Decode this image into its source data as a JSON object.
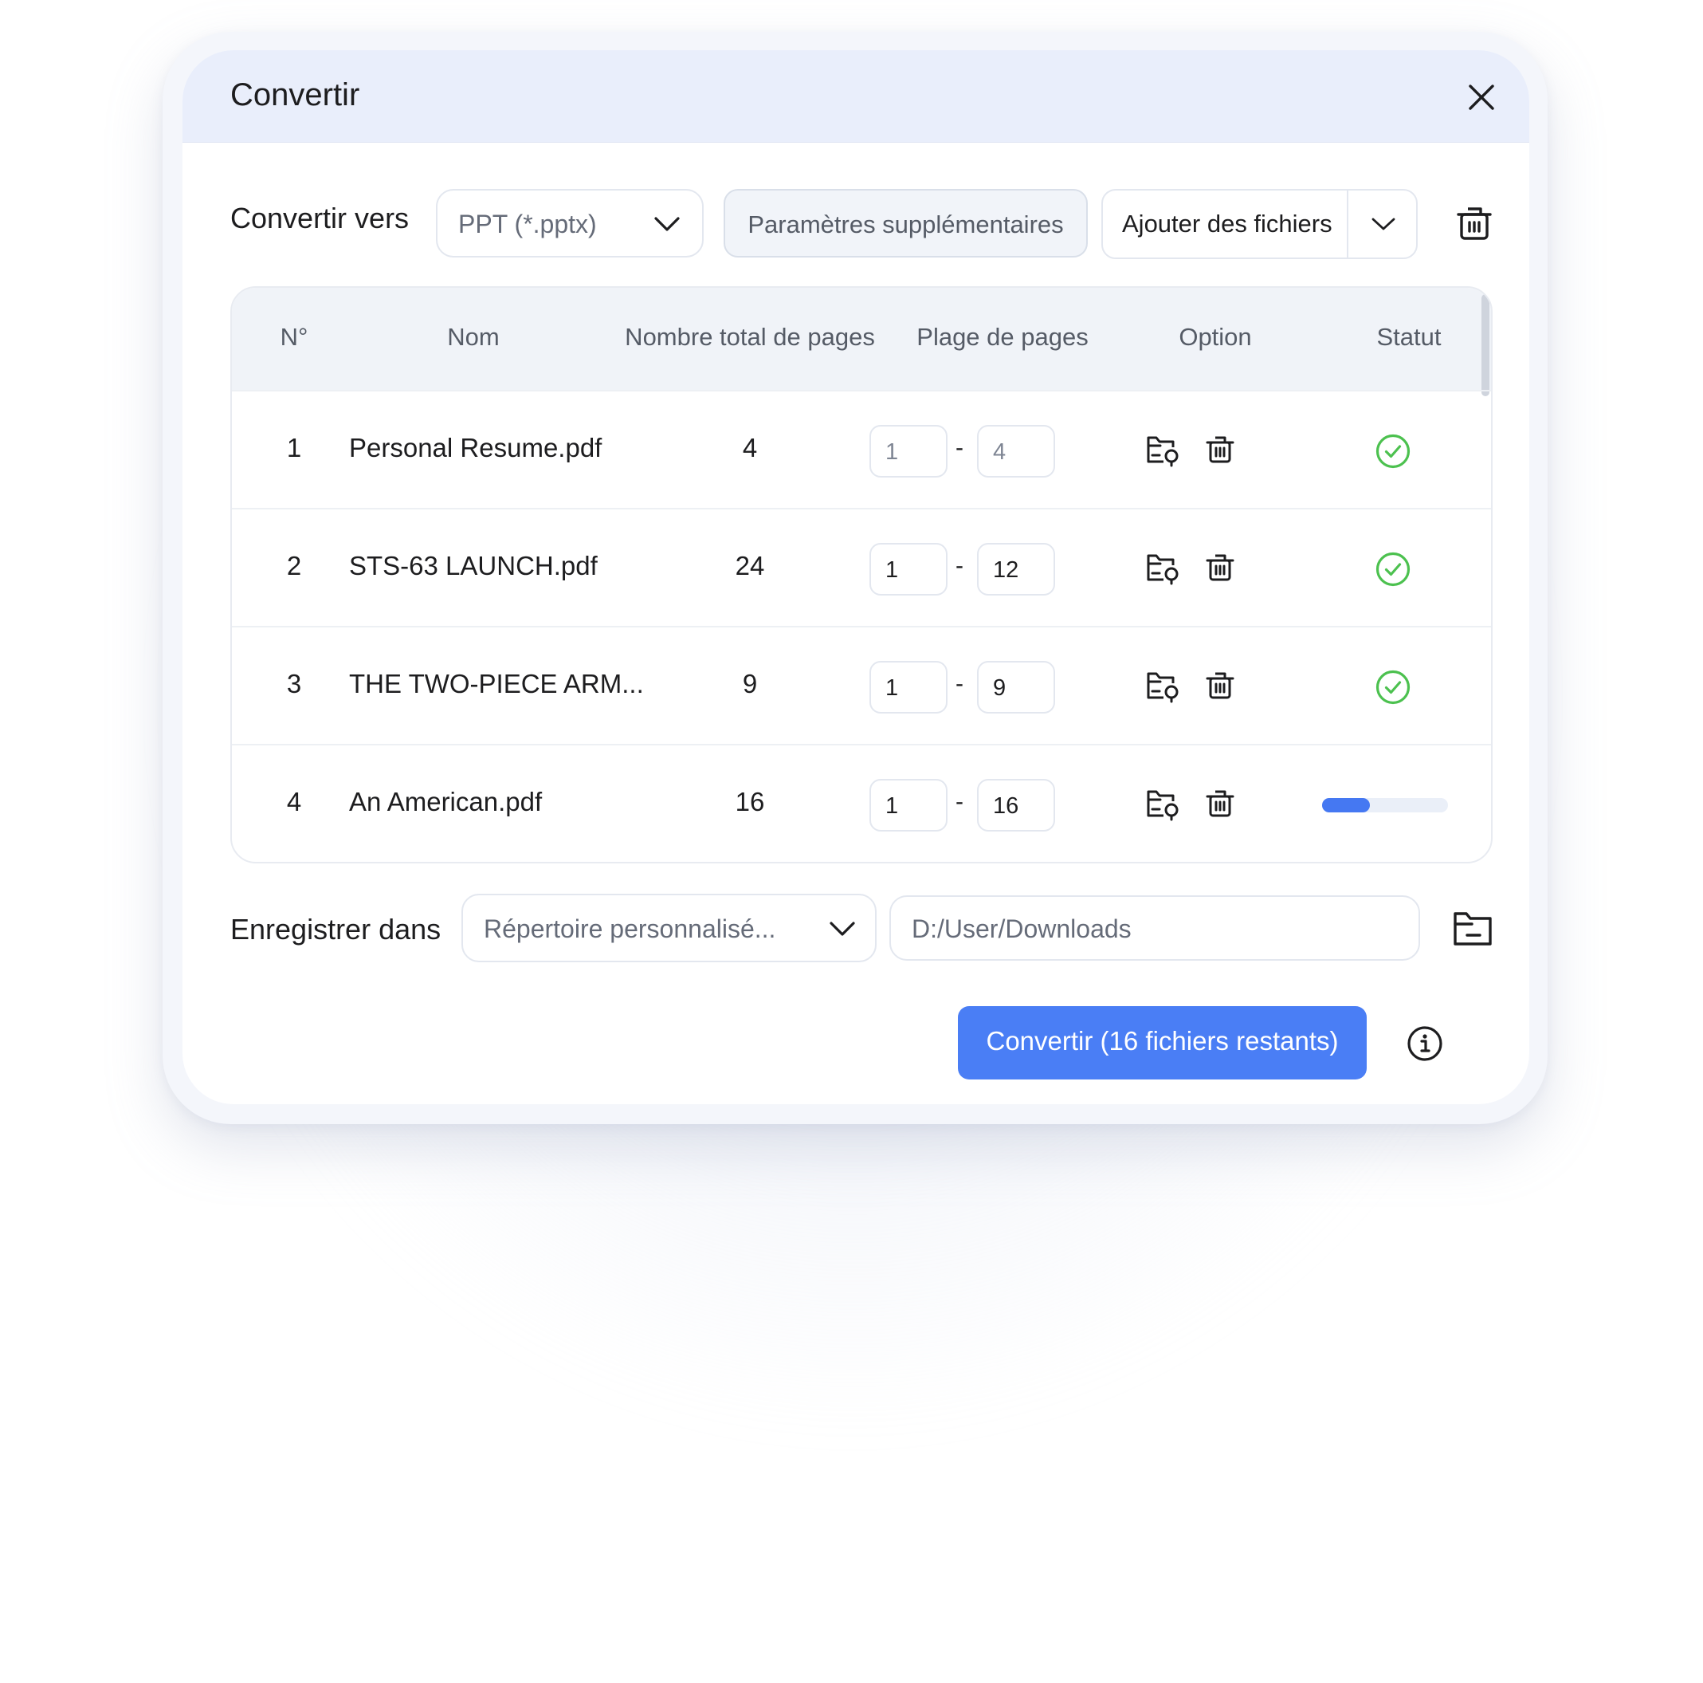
{
  "dialog": {
    "title": "Convertir",
    "close_icon": "close-icon"
  },
  "toolbar": {
    "convert_to_label": "Convertir vers",
    "format_select": "PPT (*.pptx)",
    "extra_settings_label": "Paramètres supplémentaires",
    "add_files_label": "Ajouter des fichiers",
    "clear_icon": "trash-icon"
  },
  "table": {
    "headers": [
      "N°",
      "Nom",
      "Nombre total de pages",
      "Plage de pages",
      "Option",
      "Statut"
    ],
    "rows": [
      {
        "num": "1",
        "name": "Personal Resume.pdf",
        "total": "4",
        "from": "1",
        "to": "4",
        "status": "done"
      },
      {
        "num": "2",
        "name": "STS-63 LAUNCH.pdf",
        "total": "24",
        "from": "1",
        "to": "12",
        "status": "done"
      },
      {
        "num": "3",
        "name": "THE TWO-PIECE ARM...",
        "total": "9",
        "from": "1",
        "to": "9",
        "status": "done"
      },
      {
        "num": "4",
        "name": "An American.pdf",
        "total": "16",
        "from": "1",
        "to": "16",
        "status": "in-progress",
        "progress": 0.38
      }
    ],
    "range_separator": "-"
  },
  "save": {
    "label": "Enregistrer dans",
    "location_select": "Répertoire personnalisé...",
    "path": "D:/User/Downloads",
    "browse_icon": "folder-icon"
  },
  "footer": {
    "convert_button": "Convertir (16 fichiers restants)",
    "info_icon": "info-icon"
  },
  "colors": {
    "accent": "#4a7ef5",
    "success": "#4cc14f",
    "header_bg": "#e9eefb"
  }
}
